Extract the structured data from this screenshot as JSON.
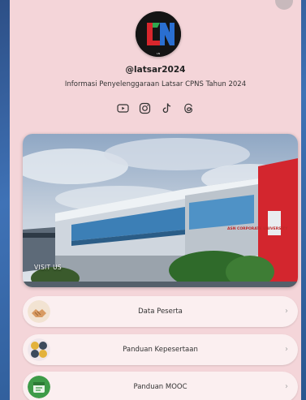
{
  "profile": {
    "logo_text": "LN",
    "handle": "@latsar2024",
    "subtitle": "Informasi Penyelenggaraan Latsar CPNS Tahun 2024"
  },
  "socials": [
    {
      "icon": "youtube-icon"
    },
    {
      "icon": "instagram-icon"
    },
    {
      "icon": "tiktok-icon"
    },
    {
      "icon": "threads-icon"
    }
  ],
  "hero": {
    "label": "VISIT US",
    "building_sign": "ASN CORPORATE UNIVERSITY"
  },
  "links": [
    {
      "label": "Data Peserta",
      "chevron": "›"
    },
    {
      "label": "Panduan Kepesertaan",
      "chevron": "›"
    },
    {
      "label": "Panduan MOOC",
      "chevron": "›"
    }
  ],
  "colors": {
    "background": "#3f72b6",
    "panel": "#f4d5d9",
    "button": "#fbeff0",
    "text": "#222222"
  }
}
